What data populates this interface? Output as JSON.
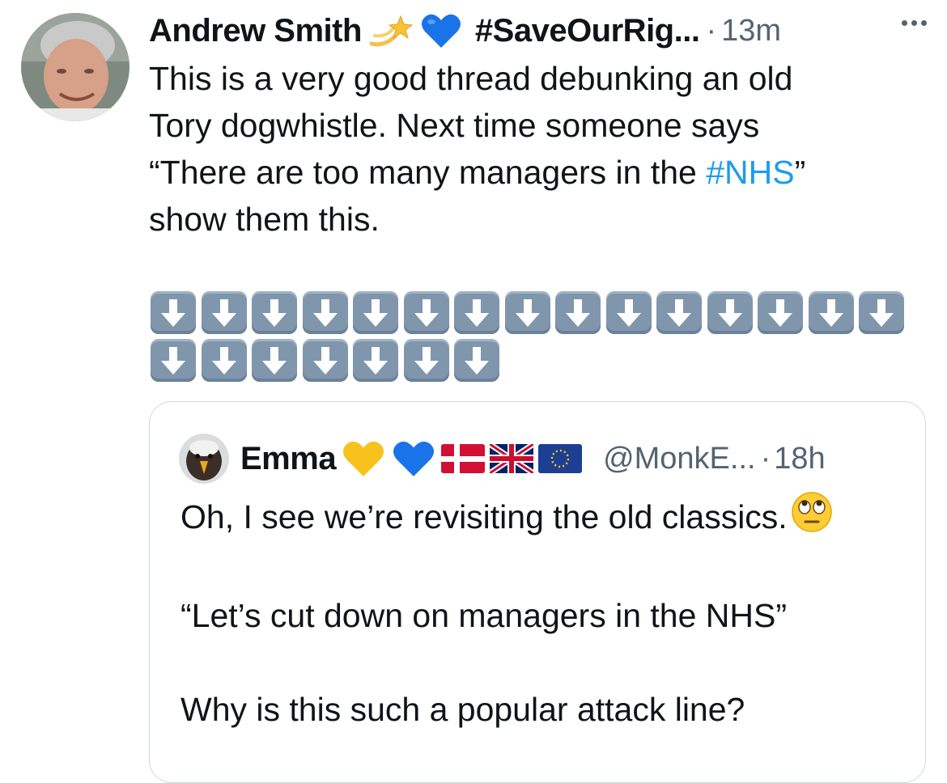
{
  "tweet": {
    "author_name": "Andrew Smith",
    "author_emojis": [
      "dizzy-star-icon",
      "blue-heart-icon"
    ],
    "author_tag": "#SaveOurRig...",
    "separator": "·",
    "time": "13m",
    "text_lines": [
      "This is a very good thread debunking an old",
      "Tory dogwhistle. Next time someone says",
      "“There are too many managers in the ",
      "show them this."
    ],
    "hashtag": "#NHS",
    "closing_quote": "”",
    "arrow_rows": [
      15,
      7
    ],
    "arrow_color": "#7f96ad",
    "hashtag_color": "#1d9bf0"
  },
  "quote": {
    "author_name": "Emma",
    "author_emojis": [
      "yellow-heart-icon",
      "blue-heart-icon",
      "denmark-flag-icon",
      "uk-flag-icon",
      "eu-flag-icon"
    ],
    "handle": "@MonkE...",
    "separator": "·",
    "time": "18h",
    "line1": "Oh, I see we’re revisiting the old classics.",
    "line2": "“Let’s cut down on managers in the NHS”",
    "line3": "Why is this such a popular attack line?"
  },
  "colors": {
    "text": "#0f1419",
    "secondary": "#536471",
    "border": "#cfd9de"
  }
}
